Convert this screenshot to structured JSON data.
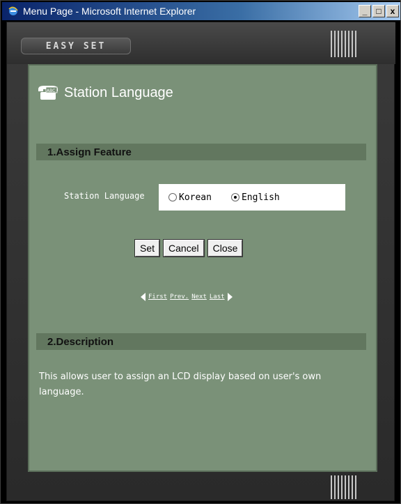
{
  "window": {
    "title": "Menu Page - Microsoft Internet Explorer",
    "controls": {
      "minimize": "_",
      "maximize": "□",
      "close": "x"
    }
  },
  "branding": {
    "logo": "EASY SET"
  },
  "page": {
    "title": "Station Language",
    "icon": "phone-abc-icon"
  },
  "assign_section": {
    "heading": "1.Assign Feature",
    "field_label": "Station Language",
    "options": [
      {
        "label": "Korean",
        "checked": false
      },
      {
        "label": "English",
        "checked": true
      }
    ],
    "buttons": {
      "set": "Set",
      "cancel": "Cancel",
      "close": "Close"
    }
  },
  "pager": {
    "first": "First",
    "prev": "Prev.",
    "next": "Next",
    "last": "Last"
  },
  "description_section": {
    "heading": "2.Description",
    "text": "This allows user to assign an LCD display based on user's own language."
  },
  "colors": {
    "panel": "#7a9178",
    "section_bar": "#62775f",
    "frame": "#333333",
    "titlebar": "#0a246a"
  }
}
